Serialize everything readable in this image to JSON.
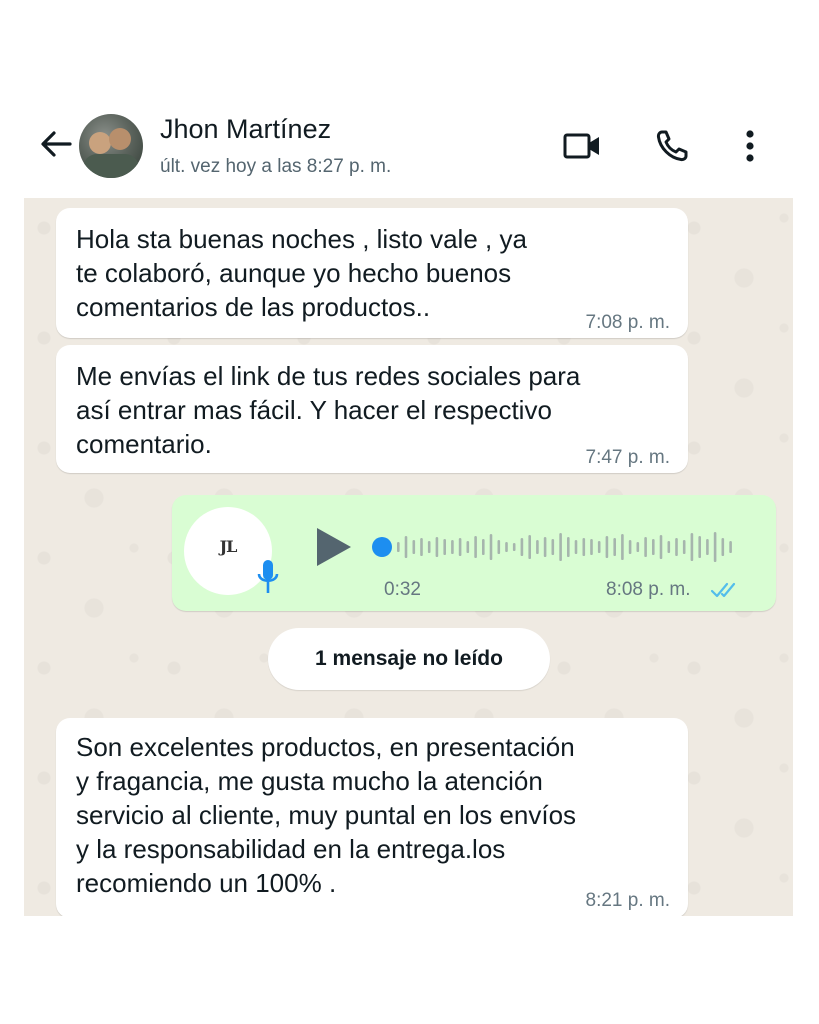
{
  "header": {
    "contact_name": "Jhon Martínez",
    "last_seen": "últ. vez hoy a las 8:27 p. m.",
    "icons": [
      "back-arrow-icon",
      "video-call-icon",
      "phone-call-icon",
      "more-options-icon"
    ]
  },
  "messages": [
    {
      "type": "incoming",
      "lines": [
        "Hola sta buenas noches , listo vale , ya",
        "te colaboró,  aunque yo hecho buenos",
        "comentarios de las productos.."
      ],
      "time": "7:08 p. m."
    },
    {
      "type": "incoming",
      "lines": [
        "Me envías el link de tus redes sociales para",
        "así entrar mas fácil. Y hacer el respectivo",
        "comentario."
      ],
      "time": "7:47 p. m."
    }
  ],
  "voice_note": {
    "avatar_text": "JL",
    "duration": "0:32",
    "time": "8:08 p. m.",
    "status": "read",
    "progress": 0
  },
  "unread_banner": "1 mensaje no leído",
  "last_message": {
    "lines": [
      "Son excelentes productos, en presentación",
      "y fragancia, me gusta mucho la atención",
      "servicio al cliente, muy puntal en los envíos",
      "y la responsabilidad en la entrega.los",
      "recomiendo un 100% ."
    ],
    "time": "8:21 p. m."
  },
  "colors": {
    "chat_background": "#efeae2",
    "outgoing_bubble": "#d9fdd3",
    "incoming_bubble": "#ffffff",
    "read_ticks": "#53bdeb",
    "scrubber": "#1d8ef0"
  }
}
